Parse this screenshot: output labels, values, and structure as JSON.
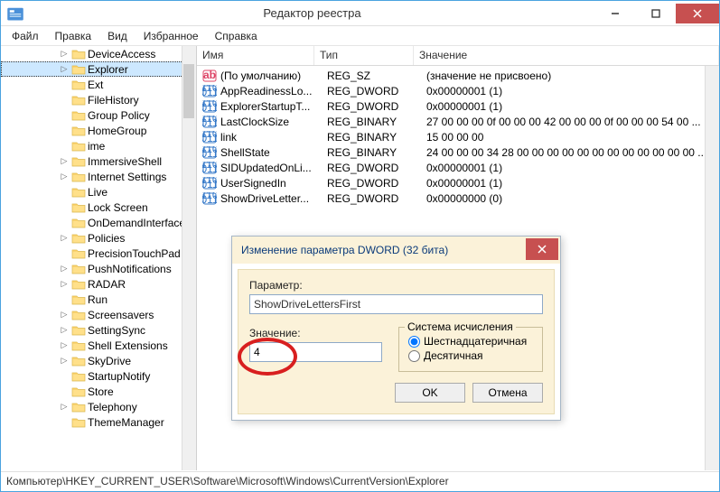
{
  "window": {
    "title": "Редактор реестра"
  },
  "menu": [
    "Файл",
    "Правка",
    "Вид",
    "Избранное",
    "Справка"
  ],
  "tree": [
    {
      "label": "DeviceAccess",
      "exp": true
    },
    {
      "label": "Explorer",
      "exp": true,
      "sel": true
    },
    {
      "label": "Ext",
      "exp": false
    },
    {
      "label": "FileHistory",
      "exp": false
    },
    {
      "label": "Group Policy",
      "exp": false
    },
    {
      "label": "HomeGroup",
      "exp": false
    },
    {
      "label": "ime",
      "exp": false
    },
    {
      "label": "ImmersiveShell",
      "exp": true
    },
    {
      "label": "Internet Settings",
      "exp": true
    },
    {
      "label": "Live",
      "exp": false
    },
    {
      "label": "Lock Screen",
      "exp": false
    },
    {
      "label": "OnDemandInterfaceCache",
      "exp": false
    },
    {
      "label": "Policies",
      "exp": true
    },
    {
      "label": "PrecisionTouchPad",
      "exp": false
    },
    {
      "label": "PushNotifications",
      "exp": true
    },
    {
      "label": "RADAR",
      "exp": true
    },
    {
      "label": "Run",
      "exp": false
    },
    {
      "label": "Screensavers",
      "exp": true
    },
    {
      "label": "SettingSync",
      "exp": true
    },
    {
      "label": "Shell Extensions",
      "exp": true
    },
    {
      "label": "SkyDrive",
      "exp": true
    },
    {
      "label": "StartupNotify",
      "exp": false
    },
    {
      "label": "Store",
      "exp": false
    },
    {
      "label": "Telephony",
      "exp": true
    },
    {
      "label": "ThemeManager",
      "exp": false
    }
  ],
  "columns": {
    "name": "Имя",
    "type": "Тип",
    "value": "Значение"
  },
  "values": [
    {
      "icon": "str",
      "name": "(По умолчанию)",
      "type": "REG_SZ",
      "value": "(значение не присвоено)"
    },
    {
      "icon": "bin",
      "name": "AppReadinessLo...",
      "type": "REG_DWORD",
      "value": "0x00000001 (1)"
    },
    {
      "icon": "bin",
      "name": "ExplorerStartupT...",
      "type": "REG_DWORD",
      "value": "0x00000001 (1)"
    },
    {
      "icon": "bin",
      "name": "LastClockSize",
      "type": "REG_BINARY",
      "value": "27 00 00 00 0f 00 00 00 42 00 00 00 0f 00 00 00 54 00 ..."
    },
    {
      "icon": "bin",
      "name": "link",
      "type": "REG_BINARY",
      "value": "15 00 00 00"
    },
    {
      "icon": "bin",
      "name": "ShellState",
      "type": "REG_BINARY",
      "value": "24 00 00 00 34 28 00 00 00 00 00 00 00 00 00 00 00 00 ..."
    },
    {
      "icon": "bin",
      "name": "SIDUpdatedOnLi...",
      "type": "REG_DWORD",
      "value": "0x00000001 (1)"
    },
    {
      "icon": "bin",
      "name": "UserSignedIn",
      "type": "REG_DWORD",
      "value": "0x00000001 (1)"
    },
    {
      "icon": "bin",
      "name": "ShowDriveLetter...",
      "type": "REG_DWORD",
      "value": "0x00000000 (0)"
    }
  ],
  "dialog": {
    "title": "Изменение параметра DWORD (32 бита)",
    "param_label": "Параметр:",
    "param_value": "ShowDriveLettersFirst",
    "value_label": "Значение:",
    "value_value": "4",
    "radix_label": "Система исчисления",
    "radix_hex": "Шестнадцатеричная",
    "radix_dec": "Десятичная",
    "ok": "OK",
    "cancel": "Отмена"
  },
  "status": "Компьютер\\HKEY_CURRENT_USER\\Software\\Microsoft\\Windows\\CurrentVersion\\Explorer"
}
